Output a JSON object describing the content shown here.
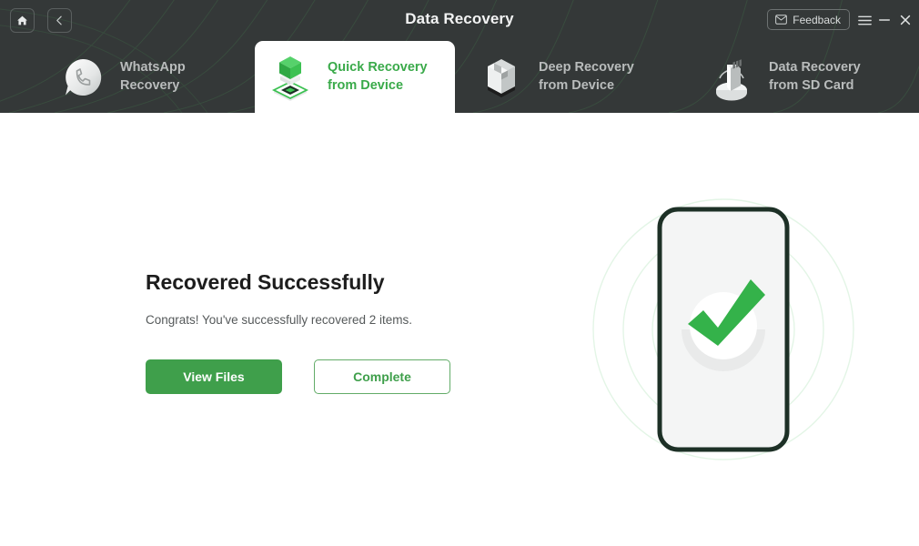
{
  "window": {
    "title": "Data Recovery",
    "home_icon": "home-icon",
    "back_icon": "chevron-left-icon",
    "feedback_label": "Feedback",
    "feedback_icon": "envelope-icon",
    "menu_icon": "hamburger-menu-icon",
    "minimize_icon": "minimize-icon",
    "close_icon": "close-icon"
  },
  "tabs": [
    {
      "label": "WhatsApp\nRecovery",
      "icon": "whatsapp-bubble-icon",
      "active": false
    },
    {
      "label": "Quick Recovery\nfrom Device",
      "icon": "green-cube-icon",
      "active": true
    },
    {
      "label": "Deep Recovery\nfrom Device",
      "icon": "open-box-icon",
      "active": false
    },
    {
      "label": "Data Recovery\nfrom SD Card",
      "icon": "sd-card-icon",
      "active": false
    }
  ],
  "main": {
    "headline": "Recovered Successfully",
    "subline": "Congrats! You've successfully recovered 2 items.",
    "primary_button": "View Files",
    "secondary_button": "Complete",
    "illustration": "phone-with-green-checkmark"
  },
  "colors": {
    "header_bg": "#343838",
    "accent_green": "#3f9f4b",
    "tab_active_green": "#3aaa4a",
    "check_green": "#34b24a",
    "phone_border": "#1d3026",
    "phone_screen": "#f4f5f5"
  }
}
